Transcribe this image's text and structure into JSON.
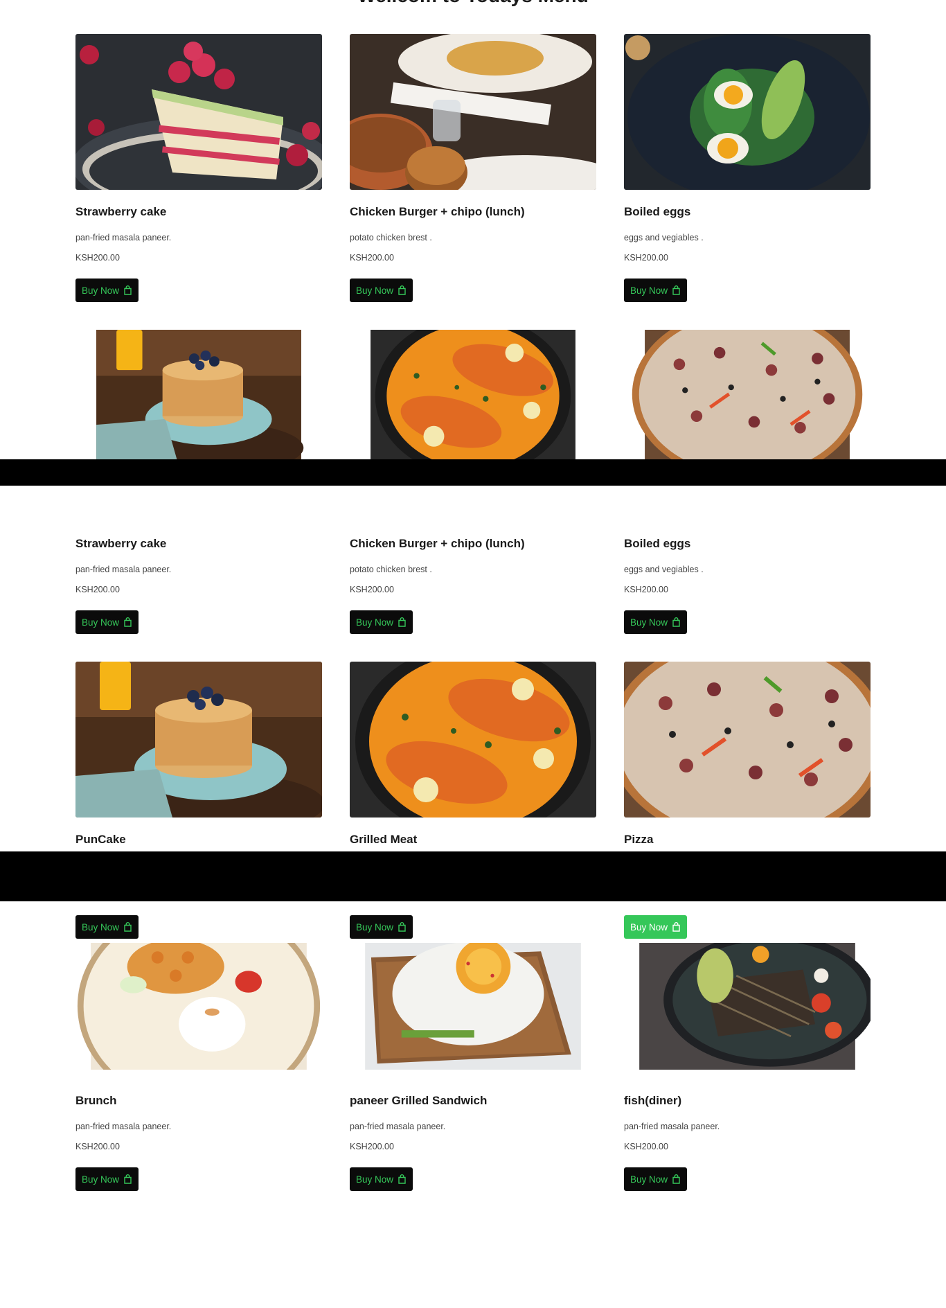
{
  "page": {
    "title": "Wellcom to Todays Menu"
  },
  "buy_label": "Buy Now",
  "accent_color": "#35c759",
  "button_bg": "#0b0b0b",
  "section_a": {
    "cards": [
      {
        "name": "Strawberry cake",
        "desc": "pan-fried masala paneer.",
        "price": "KSH200.00",
        "icon": "bag-icon"
      },
      {
        "name": "Chicken Burger + chipo (lunch)",
        "desc": "potato chicken brest .",
        "price": "KSH200.00",
        "icon": "bag-icon"
      },
      {
        "name": "Boiled eggs",
        "desc": "eggs and vegiables .",
        "price": "KSH200.00",
        "icon": "bag-icon"
      }
    ]
  },
  "section_b": {
    "cards": [
      {
        "name": "Strawberry cake",
        "desc": "pan-fried masala paneer.",
        "price": "KSH200.00"
      },
      {
        "name": "Chicken Burger + chipo (lunch)",
        "desc": "potato chicken brest .",
        "price": "KSH200.00"
      },
      {
        "name": "Boiled eggs",
        "desc": "eggs and vegiables .",
        "price": "KSH200.00"
      }
    ],
    "row2": [
      {
        "name": "PunCake"
      },
      {
        "name": "Grilled Meat"
      },
      {
        "name": "Pizza"
      }
    ]
  },
  "section_c": {
    "cards": [
      {
        "name": "Brunch",
        "desc": "pan-fried masala paneer.",
        "price": "KSH200.00"
      },
      {
        "name": "paneer Grilled Sandwich",
        "desc": "pan-fried masala paneer.",
        "price": "KSH200.00"
      },
      {
        "name": "fish(diner)",
        "desc": "pan-fried masala paneer.",
        "price": "KSH200.00"
      }
    ]
  }
}
